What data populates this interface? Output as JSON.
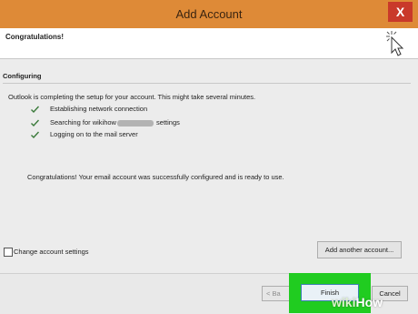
{
  "window": {
    "title": "Add Account",
    "close_label": "X"
  },
  "header": {
    "title": "Congratulations!"
  },
  "section": {
    "title": "Configuring",
    "intro": "Outlook is completing the setup for your account. This might take several minutes."
  },
  "steps": [
    {
      "label": "Establishing network connection"
    },
    {
      "label_before": "Searching for wikihow",
      "label_after": " settings"
    },
    {
      "label": "Logging on to the mail server"
    }
  ],
  "message": "Congratulations! Your email account was successfully configured and is ready to use.",
  "options": {
    "change_settings_label": "Change account settings",
    "change_settings_checked": false
  },
  "buttons": {
    "add_another": "Add another account...",
    "back": "< Ba",
    "finish": "Finish",
    "cancel": "Cancel"
  },
  "watermark": {
    "wiki": "wiki",
    "how": "How"
  },
  "colors": {
    "titlebar": "#de8a37",
    "close": "#c9392a",
    "highlight": "#20cc20",
    "check": "#3a7a3a"
  },
  "icons": {
    "cursor": "cursor-sparkle-icon",
    "check": "checkmark-icon"
  }
}
